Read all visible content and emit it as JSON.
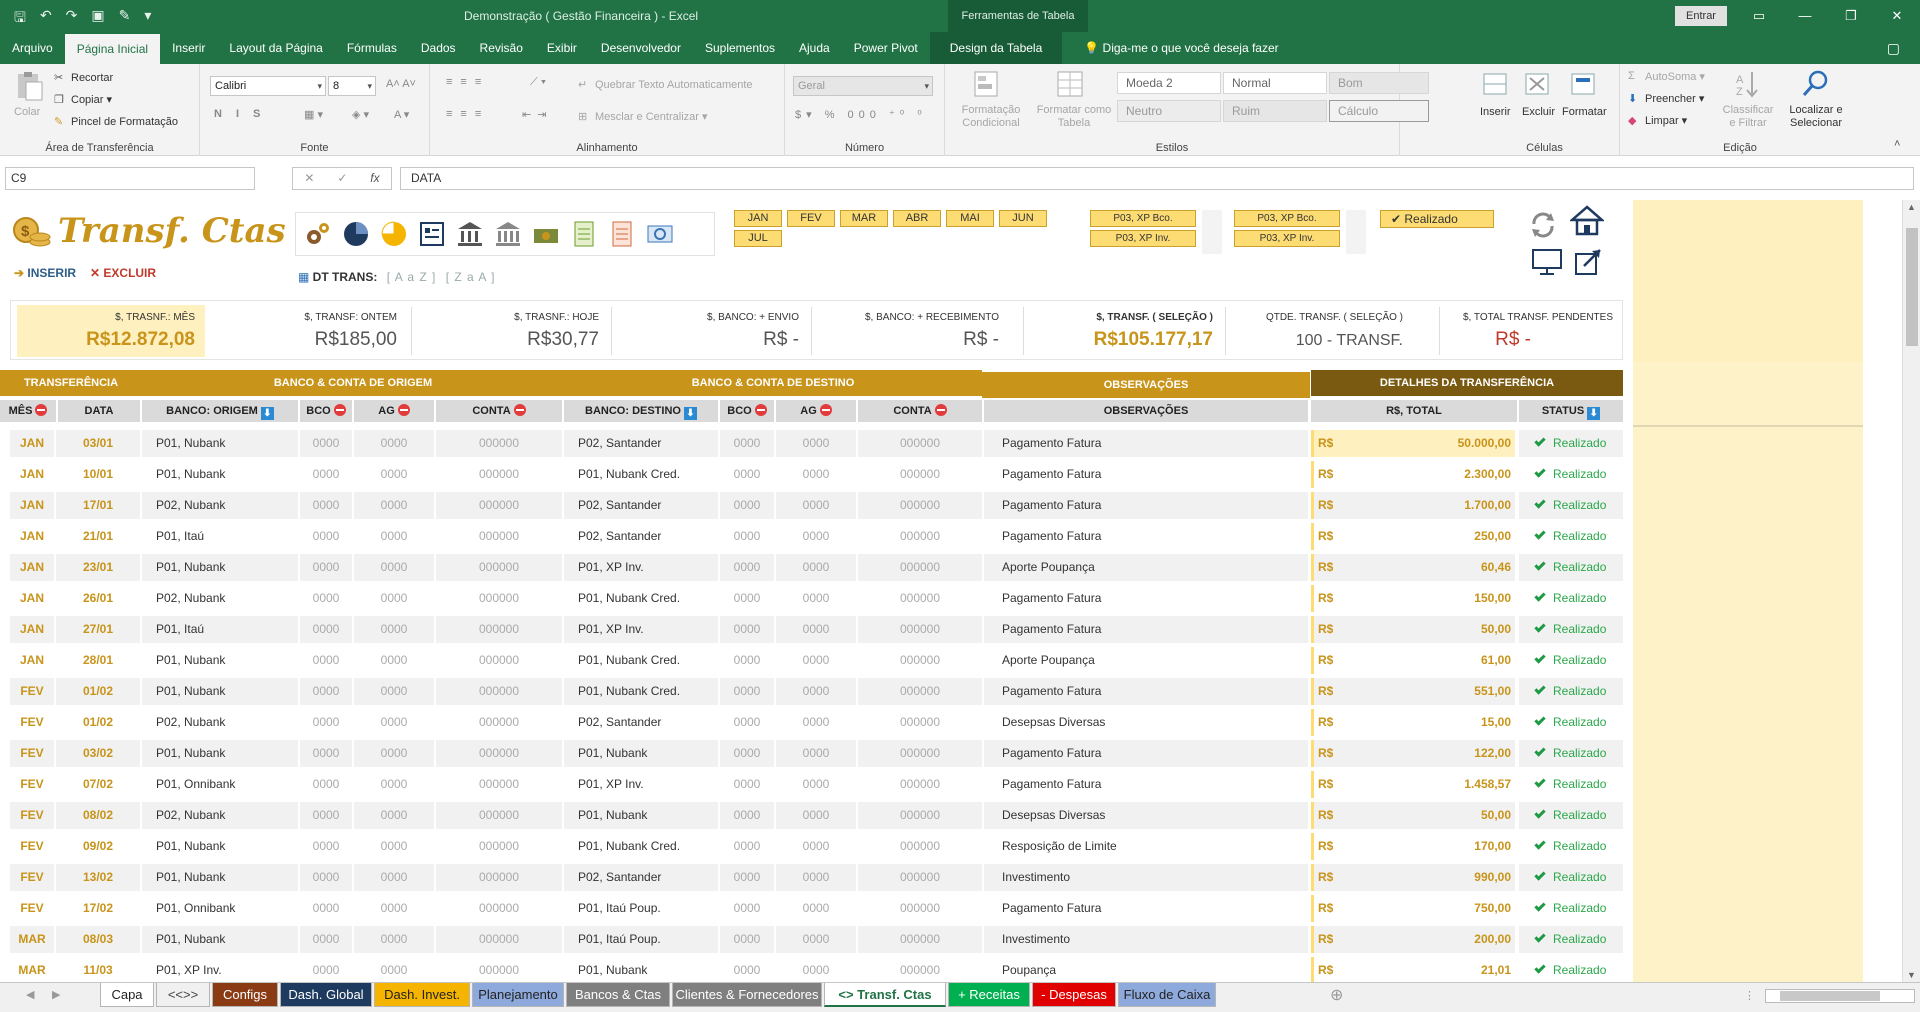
{
  "window": {
    "title": "Demonstração ( Gestão Financeira ) - Excel",
    "tool_tab": "Ferramentas de Tabela",
    "signin": "Entrar"
  },
  "ribbon_tabs": [
    "Arquivo",
    "Página Inicial",
    "Inserir",
    "Layout da Página",
    "Fórmulas",
    "Dados",
    "Revisão",
    "Exibir",
    "Desenvolvedor",
    "Suplementos",
    "Ajuda",
    "Power Pivot"
  ],
  "design_tab": "Design da Tabela",
  "tell_me": "Diga-me o que você deseja fazer",
  "ribbon": {
    "clipboard": {
      "paste": "Colar",
      "cut": "Recortar",
      "copy": "Copiar",
      "painter": "Pincel de Formatação",
      "label": "Área de Transferência"
    },
    "font": {
      "name": "Calibri",
      "size": "8",
      "label": "Fonte"
    },
    "align": {
      "wrap": "Quebrar Texto Automaticamente",
      "merge": "Mesclar e Centralizar",
      "label": "Alinhamento"
    },
    "number": {
      "format": "Geral",
      "label": "Número"
    },
    "styles": {
      "cond": "Formatação Condicional",
      "astable": "Formatar como Tabela",
      "moeda2": "Moeda 2",
      "normal": "Normal",
      "bom": "Bom",
      "neutro": "Neutro",
      "ruim": "Ruim",
      "calculo": "Cálculo",
      "label": "Estilos"
    },
    "cells": {
      "insert": "Inserir",
      "delete": "Excluir",
      "format": "Formatar",
      "label": "Células"
    },
    "edit": {
      "autosum": "AutoSoma",
      "fill": "Preencher",
      "clear": "Limpar",
      "sort": "Classificar e Filtrar",
      "find": "Localizar e Selecionar",
      "label": "Edição"
    }
  },
  "formula_bar": {
    "cell": "C9",
    "formula": "DATA"
  },
  "sheet": {
    "logo_text": "Transf. Ctas",
    "insert": "INSERIR",
    "delete": "EXCLUIR",
    "dt_label": "DT TRANS:",
    "sort_az": "[ A a Z ]",
    "sort_za": "[ Z a A ]",
    "months": [
      "JAN",
      "FEV",
      "MAR",
      "ABR",
      "MAI",
      "JUN",
      "JUL"
    ],
    "accounts": [
      "P03, XP Bco.",
      "P03, XP Inv.",
      "P03, XP Bco.",
      "P03, XP Inv."
    ],
    "status_btn": "Realizado"
  },
  "kpis": [
    {
      "label": "$, TRASNF.: MÊS",
      "value": "R$12.872,08"
    },
    {
      "label": "$, TRANSF: ONTEM",
      "value": "R$185,00"
    },
    {
      "label": "$, TRASNF.: HOJE",
      "value": "R$30,77"
    },
    {
      "label": "$, BANCO: + ENVIO",
      "value": "R$ -"
    },
    {
      "label": "$, BANCO: + RECEBIMENTO",
      "value": "R$ -"
    },
    {
      "label": "$, TRANSF. ( SELEÇÃO )",
      "value": "R$105.177,17"
    },
    {
      "label": "QTDE. TRANSF. ( SELEÇÃO )",
      "value": "100 - TRANSF."
    },
    {
      "label": "$, TOTAL TRANSF. PENDENTES",
      "value": "R$ -"
    }
  ],
  "section_headers": [
    "TRANSFERÊNCIA",
    "BANCO & CONTA DE ORIGEM",
    "BANCO & CONTA DE DESTINO",
    "OBSERVAÇÕES",
    "DETALHES DA TRANSFERÊNCIA"
  ],
  "columns": [
    "MÊS",
    "DATA",
    "BANCO: ORIGEM",
    "BCO",
    "AG",
    "CONTA",
    "BANCO: DESTINO",
    "BCO",
    "AG",
    "CONTA",
    "OBSERVAÇÕES",
    "R$, TOTAL",
    "STATUS"
  ],
  "rows": [
    {
      "mes": "JAN",
      "data": "03/01",
      "orig": "P01, Nubank",
      "bco": "0000",
      "ag": "0000",
      "conta": "000000",
      "dest": "P02, Santander",
      "bco2": "0000",
      "ag2": "0000",
      "conta2": "000000",
      "obs": "Pagamento Fatura",
      "cur": "R$",
      "valor": "50.000,00",
      "status": "Realizado"
    },
    {
      "mes": "JAN",
      "data": "10/01",
      "orig": "P01, Nubank",
      "bco": "0000",
      "ag": "0000",
      "conta": "000000",
      "dest": "P01, Nubank Cred.",
      "bco2": "0000",
      "ag2": "0000",
      "conta2": "000000",
      "obs": "Pagamento Fatura",
      "cur": "R$",
      "valor": "2.300,00",
      "status": "Realizado"
    },
    {
      "mes": "JAN",
      "data": "17/01",
      "orig": "P02, Nubank",
      "bco": "0000",
      "ag": "0000",
      "conta": "000000",
      "dest": "P02, Santander",
      "bco2": "0000",
      "ag2": "0000",
      "conta2": "000000",
      "obs": "Pagamento Fatura",
      "cur": "R$",
      "valor": "1.700,00",
      "status": "Realizado"
    },
    {
      "mes": "JAN",
      "data": "21/01",
      "orig": "P01, Itaú",
      "bco": "0000",
      "ag": "0000",
      "conta": "000000",
      "dest": "P02, Santander",
      "bco2": "0000",
      "ag2": "0000",
      "conta2": "000000",
      "obs": "Pagamento Fatura",
      "cur": "R$",
      "valor": "250,00",
      "status": "Realizado"
    },
    {
      "mes": "JAN",
      "data": "23/01",
      "orig": "P01, Nubank",
      "bco": "0000",
      "ag": "0000",
      "conta": "000000",
      "dest": "P01, XP Inv.",
      "bco2": "0000",
      "ag2": "0000",
      "conta2": "000000",
      "obs": "Aporte Poupança",
      "cur": "R$",
      "valor": "60,46",
      "status": "Realizado"
    },
    {
      "mes": "JAN",
      "data": "26/01",
      "orig": "P02, Nubank",
      "bco": "0000",
      "ag": "0000",
      "conta": "000000",
      "dest": "P01, Nubank Cred.",
      "bco2": "0000",
      "ag2": "0000",
      "conta2": "000000",
      "obs": "Pagamento Fatura",
      "cur": "R$",
      "valor": "150,00",
      "status": "Realizado"
    },
    {
      "mes": "JAN",
      "data": "27/01",
      "orig": "P01, Itaú",
      "bco": "0000",
      "ag": "0000",
      "conta": "000000",
      "dest": "P01, XP Inv.",
      "bco2": "0000",
      "ag2": "0000",
      "conta2": "000000",
      "obs": "Pagamento Fatura",
      "cur": "R$",
      "valor": "50,00",
      "status": "Realizado"
    },
    {
      "mes": "JAN",
      "data": "28/01",
      "orig": "P01, Nubank",
      "bco": "0000",
      "ag": "0000",
      "conta": "000000",
      "dest": "P01, Nubank Cred.",
      "bco2": "0000",
      "ag2": "0000",
      "conta2": "000000",
      "obs": "Aporte Poupança",
      "cur": "R$",
      "valor": "61,00",
      "status": "Realizado"
    },
    {
      "mes": "FEV",
      "data": "01/02",
      "orig": "P01, Nubank",
      "bco": "0000",
      "ag": "0000",
      "conta": "000000",
      "dest": "P01, Nubank Cred.",
      "bco2": "0000",
      "ag2": "0000",
      "conta2": "000000",
      "obs": "Pagamento Fatura",
      "cur": "R$",
      "valor": "551,00",
      "status": "Realizado"
    },
    {
      "mes": "FEV",
      "data": "01/02",
      "orig": "P02, Nubank",
      "bco": "0000",
      "ag": "0000",
      "conta": "000000",
      "dest": "P02, Santander",
      "bco2": "0000",
      "ag2": "0000",
      "conta2": "000000",
      "obs": "Desepsas Diversas",
      "cur": "R$",
      "valor": "15,00",
      "status": "Realizado"
    },
    {
      "mes": "FEV",
      "data": "03/02",
      "orig": "P01, Nubank",
      "bco": "0000",
      "ag": "0000",
      "conta": "000000",
      "dest": "P01, Nubank",
      "bco2": "0000",
      "ag2": "0000",
      "conta2": "000000",
      "obs": "Pagamento Fatura",
      "cur": "R$",
      "valor": "122,00",
      "status": "Realizado"
    },
    {
      "mes": "FEV",
      "data": "07/02",
      "orig": "P01, Onnibank",
      "bco": "0000",
      "ag": "0000",
      "conta": "000000",
      "dest": "P01, XP Inv.",
      "bco2": "0000",
      "ag2": "0000",
      "conta2": "000000",
      "obs": "Pagamento Fatura",
      "cur": "R$",
      "valor": "1.458,57",
      "status": "Realizado"
    },
    {
      "mes": "FEV",
      "data": "08/02",
      "orig": "P02, Nubank",
      "bco": "0000",
      "ag": "0000",
      "conta": "000000",
      "dest": "P01, Nubank",
      "bco2": "0000",
      "ag2": "0000",
      "conta2": "000000",
      "obs": "Desepsas Diversas",
      "cur": "R$",
      "valor": "50,00",
      "status": "Realizado"
    },
    {
      "mes": "FEV",
      "data": "09/02",
      "orig": "P01, Nubank",
      "bco": "0000",
      "ag": "0000",
      "conta": "000000",
      "dest": "P01, Nubank Cred.",
      "bco2": "0000",
      "ag2": "0000",
      "conta2": "000000",
      "obs": "Resposição de Limite",
      "cur": "R$",
      "valor": "170,00",
      "status": "Realizado"
    },
    {
      "mes": "FEV",
      "data": "13/02",
      "orig": "P01, Nubank",
      "bco": "0000",
      "ag": "0000",
      "conta": "000000",
      "dest": "P02, Santander",
      "bco2": "0000",
      "ag2": "0000",
      "conta2": "000000",
      "obs": "Investimento",
      "cur": "R$",
      "valor": "990,00",
      "status": "Realizado"
    },
    {
      "mes": "FEV",
      "data": "17/02",
      "orig": "P01, Onnibank",
      "bco": "0000",
      "ag": "0000",
      "conta": "000000",
      "dest": "P01, Itaú Poup.",
      "bco2": "0000",
      "ag2": "0000",
      "conta2": "000000",
      "obs": "Pagamento Fatura",
      "cur": "R$",
      "valor": "750,00",
      "status": "Realizado"
    },
    {
      "mes": "MAR",
      "data": "08/03",
      "orig": "P01, Nubank",
      "bco": "0000",
      "ag": "0000",
      "conta": "000000",
      "dest": "P01, Itaú Poup.",
      "bco2": "0000",
      "ag2": "0000",
      "conta2": "000000",
      "obs": "Investimento",
      "cur": "R$",
      "valor": "200,00",
      "status": "Realizado"
    },
    {
      "mes": "MAR",
      "data": "11/03",
      "orig": "P01, XP Inv.",
      "bco": "0000",
      "ag": "0000",
      "conta": "000000",
      "dest": "P01, Nubank",
      "bco2": "0000",
      "ag2": "0000",
      "conta2": "000000",
      "obs": "Poupança",
      "cur": "R$",
      "valor": "21,01",
      "status": "Realizado"
    }
  ],
  "sheet_tabs": [
    {
      "name": "Capa",
      "bg": "#ffffff",
      "fg": "#222222"
    },
    {
      "name": "<<>>",
      "bg": "#f0f0f0",
      "fg": "#444444"
    },
    {
      "name": "Configs",
      "bg": "#8a3b14",
      "fg": "#ffffff"
    },
    {
      "name": "Dash. Global",
      "bg": "#1f3a5f",
      "fg": "#ffffff"
    },
    {
      "name": "Dash. Invest.",
      "bg": "#f4b400",
      "fg": "#222222"
    },
    {
      "name": "Planejamento",
      "bg": "#8ea9db",
      "fg": "#222222"
    },
    {
      "name": "Bancos & Ctas",
      "bg": "#7f7f7f",
      "fg": "#ffffff"
    },
    {
      "name": "Clientes & Fornecedores",
      "bg": "#7f7f7f",
      "fg": "#ffffff"
    },
    {
      "name": "<> Transf. Ctas",
      "bg": "#ffffff",
      "fg": "#217346"
    },
    {
      "name": "+ Receitas",
      "bg": "#00b050",
      "fg": "#ffffff"
    },
    {
      "name": "- Despesas",
      "bg": "#e00000",
      "fg": "#ffffff"
    },
    {
      "name": "Fluxo de Caixa",
      "bg": "#8ea9db",
      "fg": "#222222"
    }
  ],
  "colors": {
    "excel_green": "#217346",
    "gold": "#c8941a",
    "dark_gold": "#7a5911",
    "status_green": "#1f9a44"
  }
}
